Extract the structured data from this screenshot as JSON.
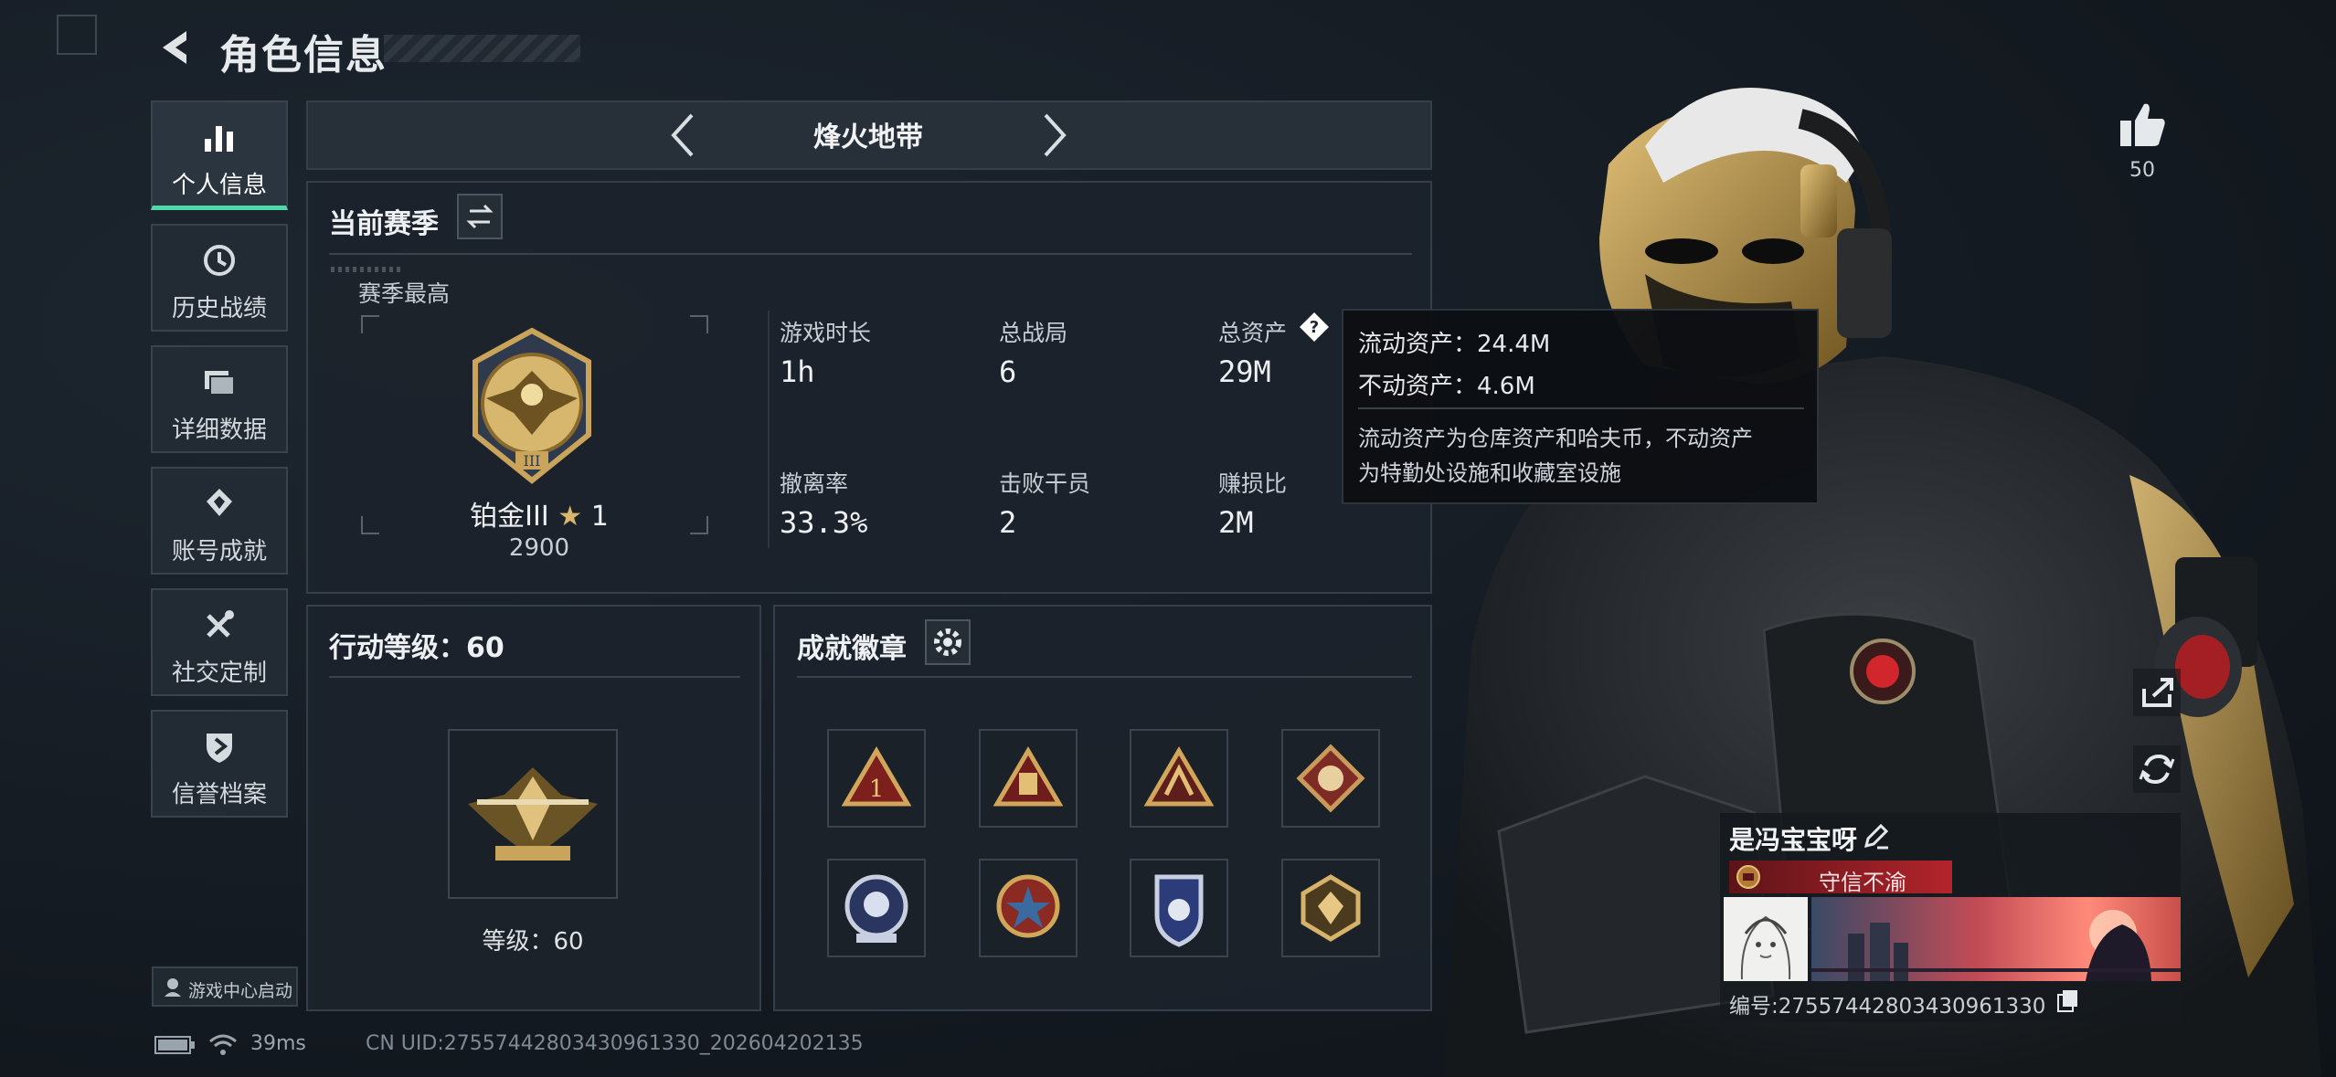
{
  "header": {
    "title": "角色信息"
  },
  "sidebar": {
    "items": [
      {
        "label": "个人信息"
      },
      {
        "label": "历史战绩"
      },
      {
        "label": "详细数据"
      },
      {
        "label": "账号成就"
      },
      {
        "label": "社交定制"
      },
      {
        "label": "信誉档案"
      }
    ],
    "launch_label": "游戏中心启动"
  },
  "mode_selector": {
    "label": "烽火地带"
  },
  "season": {
    "title": "当前赛季",
    "best_label": "赛季最高",
    "rank_name": "铂金III",
    "rank_stars": "1",
    "rank_points": "2900",
    "stats": [
      {
        "label": "游戏时长",
        "value": "1h"
      },
      {
        "label": "总战局",
        "value": "6"
      },
      {
        "label": "总资产",
        "value": "29M"
      },
      {
        "label": "撤离率",
        "value": "33.3%"
      },
      {
        "label": "击败干员",
        "value": "2"
      },
      {
        "label": "赚损比",
        "value": "2M"
      }
    ]
  },
  "tooltip": {
    "line1": "流动资产：24.4M",
    "line2": "不动资产：4.6M",
    "desc1": "流动资产为仓库资产和哈夫币，不动资产",
    "desc2": "为特勤处设施和收藏室设施"
  },
  "action_level": {
    "title": "行动等级：60",
    "level_text": "等级：60"
  },
  "badges": {
    "title": "成就徽章",
    "items": [
      "badge-1",
      "badge-2",
      "badge-3",
      "badge-4",
      "badge-5",
      "badge-6",
      "badge-7",
      "badge-8"
    ]
  },
  "likes": {
    "count": "50"
  },
  "player": {
    "name": "是冯宝宝呀",
    "reputation": "守信不渝",
    "id_text": "编号:2755744280343096133​0"
  },
  "status_bar": {
    "ping": "39ms",
    "uid": "CN UID:27557442803430961330_202604202135"
  },
  "colors": {
    "accent": "#4fd9a6",
    "gold": "#c9a45a",
    "rep_red": "#b3242b"
  }
}
